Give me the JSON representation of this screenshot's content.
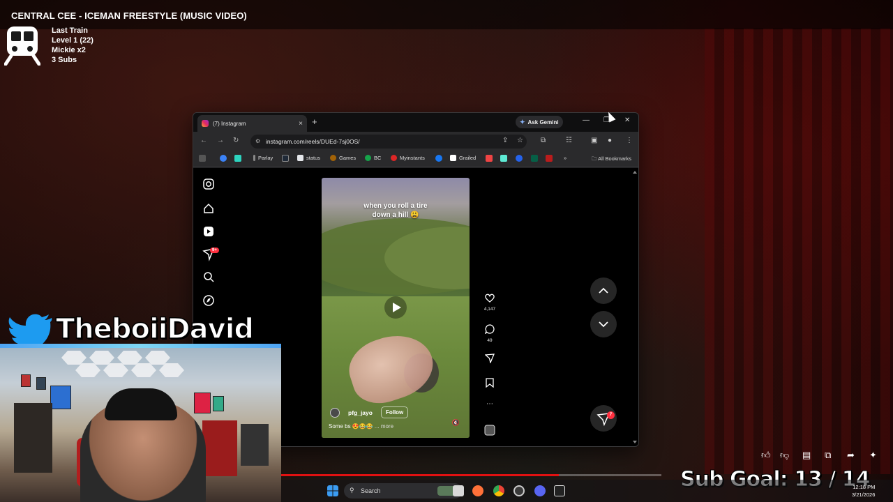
{
  "stream": {
    "title": "CENTRAL CEE - ICEMAN FREESTYLE (MUSIC VIDEO)",
    "info": [
      "Last Train",
      "Level 1  (22)",
      "Mickie x2",
      "3 Subs"
    ],
    "twitter_handle": "TheboiiDavid",
    "sub_goal": "Sub Goal:  13 / 14",
    "video_progress_fraction": 0.73
  },
  "browser": {
    "tab_title": "(7) Instagram",
    "tab_close": "×",
    "new_tab": "+",
    "gemini_label": "Ask Gemini",
    "url": "instagram.com/reels/DUEd-7sj0OS/",
    "bookmarks": [
      "Parlay",
      "status",
      "Games",
      "BC",
      "Myinstants",
      "Grailed"
    ],
    "all_bookmarks": "All Bookmarks",
    "overflow": "»"
  },
  "instagram": {
    "notification_badge": "9+",
    "reel_caption_line1": "when you roll a tire",
    "reel_caption_line2": "down a hill 😩",
    "username": "pfg_jayo",
    "follow_label": "Follow",
    "description": "Some bs 😍😂😂",
    "more_label": "... more",
    "likes": "4,147",
    "comments": "49",
    "messages_badge": "7"
  },
  "taskbar": {
    "search_label": "Search",
    "time": "12:18 PM",
    "date": "3/21/2026"
  },
  "colors": {
    "accent_red": "#ff3040",
    "progress_red": "#e11111",
    "twitter_blue": "#1d9bf0"
  }
}
